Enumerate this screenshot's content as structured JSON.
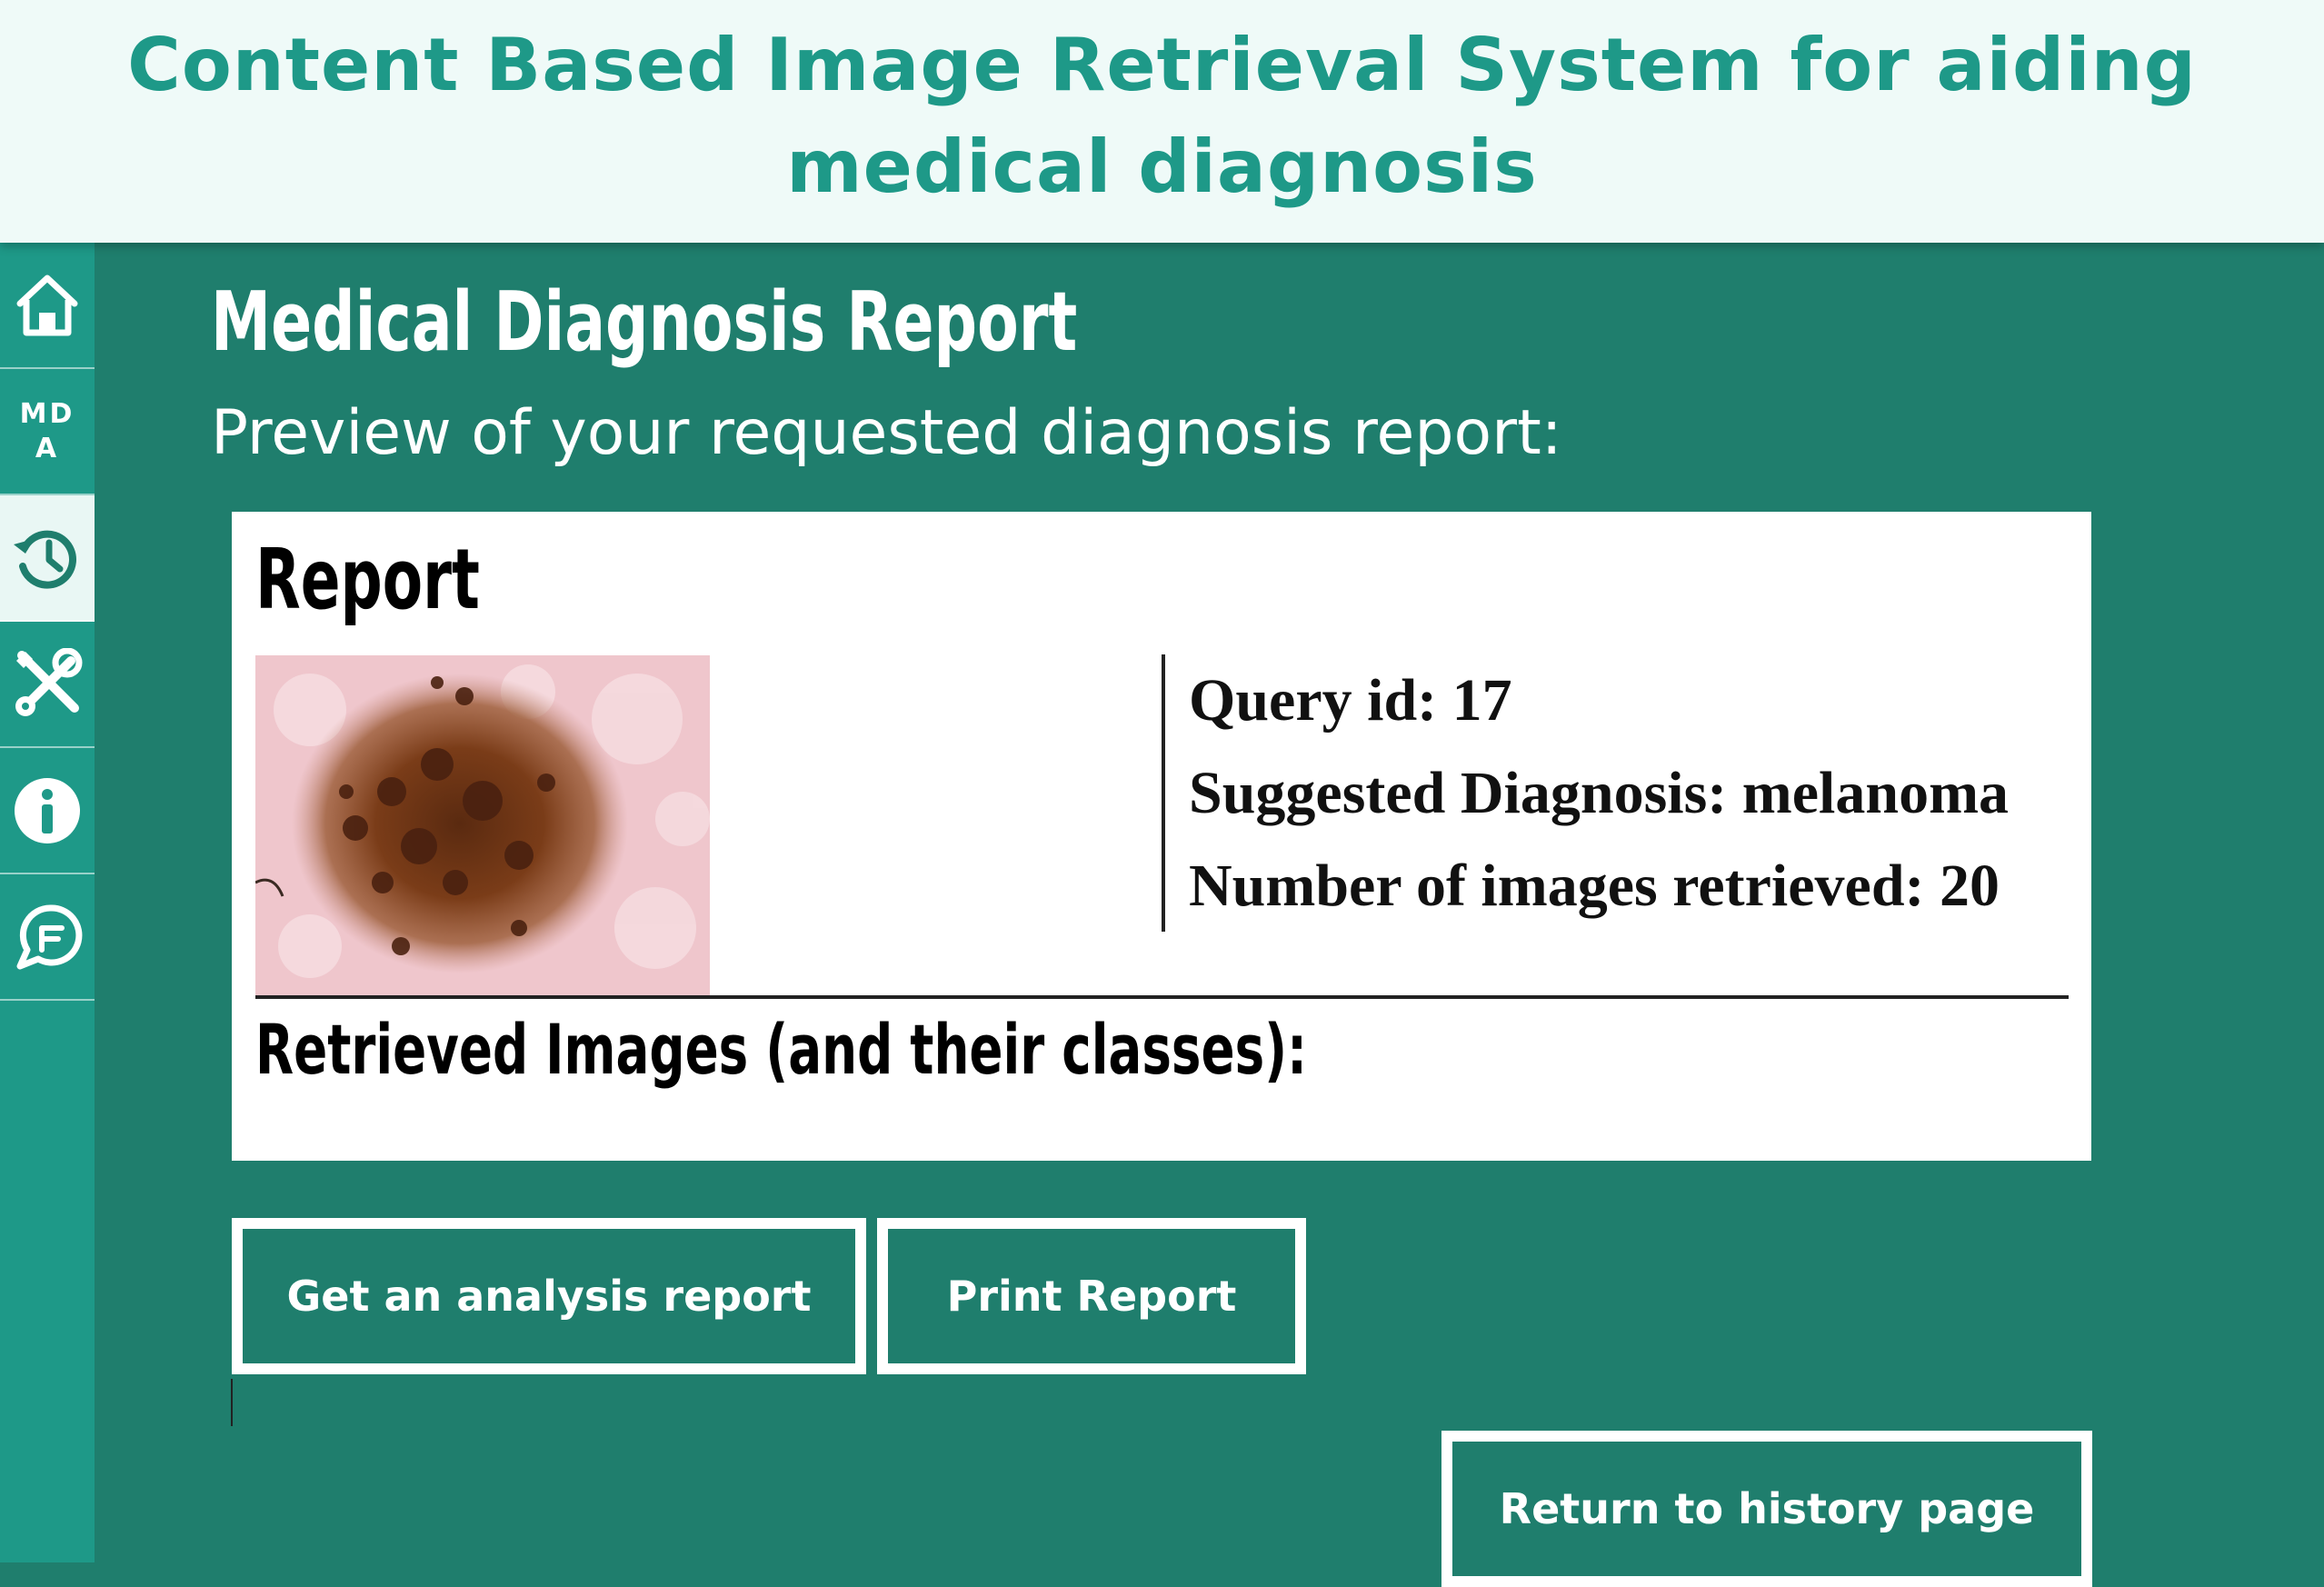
{
  "header": {
    "title": "Content Based Image Retrieval System for aiding medical diagnosis"
  },
  "sidebar": {
    "items": [
      {
        "icon": "home-icon"
      },
      {
        "icon": "mda-logo-icon",
        "label": "MD A"
      },
      {
        "icon": "history-icon",
        "active": true
      },
      {
        "icon": "tools-icon"
      },
      {
        "icon": "info-icon"
      },
      {
        "icon": "feedback-icon"
      }
    ]
  },
  "page": {
    "title": "Medical Diagnosis Report",
    "subtitle": "Preview of your requested diagnosis report:"
  },
  "report": {
    "heading": "Report",
    "query_id_line": "Query id: 17",
    "diagnosis_line": "Suggested Diagnosis: melanoma",
    "count_line": "Number of images retrieved: 20",
    "retrieved_heading": "Retrieved Images (and their classes):"
  },
  "buttons": {
    "analysis": "Get an analysis report",
    "print": "Print Report",
    "return": "Return to history page"
  },
  "colors": {
    "background": "#1f7e6d",
    "sidebar": "#1e9988",
    "header_bg": "#effaf8",
    "title_teal": "#1e9988"
  }
}
